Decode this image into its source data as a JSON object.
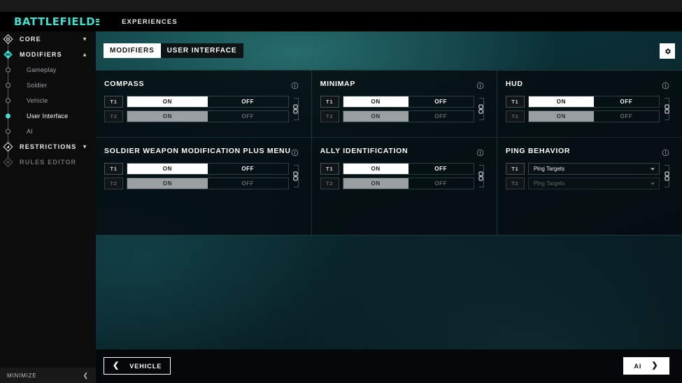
{
  "app": {
    "logo": "BATTLEFIELD",
    "nav_experiences": "EXPERIENCES",
    "accent": "#3fe0d0",
    "minimize_label": "MINIMIZE",
    "minimize_icon": "chevron-left-icon"
  },
  "sidebar": {
    "groups": [
      {
        "label": "CORE",
        "icon": "diamond-core-icon",
        "chevron": "chevron-down-icon",
        "expanded": false
      },
      {
        "label": "MODIFIERS",
        "icon": "diamond-modifiers-icon",
        "chevron": "chevron-up-icon",
        "expanded": true
      },
      {
        "label": "RESTRICTIONS",
        "icon": "diamond-restrictions-icon",
        "chevron": "chevron-down-icon",
        "expanded": false
      },
      {
        "label": "RULES EDITOR",
        "icon": "diamond-rules-icon",
        "chevron": "",
        "expanded": false
      }
    ],
    "modifier_items": [
      {
        "label": "Gameplay",
        "active": false
      },
      {
        "label": "Soldier",
        "active": false
      },
      {
        "label": "Vehicle",
        "active": false
      },
      {
        "label": "User Interface",
        "active": true
      },
      {
        "label": "AI",
        "active": false
      }
    ]
  },
  "tabs": [
    {
      "label": "MODIFIERS",
      "active": true
    },
    {
      "label": "USER INTERFACE",
      "active": false
    }
  ],
  "toolbar": {
    "settings_icon": "gear-icon"
  },
  "cards": [
    {
      "title": "COMPASS",
      "info_icon": "info-icon",
      "link_icon": "link-icon",
      "type": "toggle",
      "options": [
        "ON",
        "OFF"
      ],
      "rows": [
        {
          "team": "T1",
          "value": "ON",
          "enabled": true
        },
        {
          "team": "T2",
          "value": "ON",
          "enabled": false
        }
      ]
    },
    {
      "title": "SOLDIER WEAPON MODIFICATION PLUS MENU",
      "info_icon": "info-icon",
      "link_icon": "link-icon",
      "type": "toggle",
      "options": [
        "ON",
        "OFF"
      ],
      "rows": [
        {
          "team": "T1",
          "value": "ON",
          "enabled": true
        },
        {
          "team": "T2",
          "value": "ON",
          "enabled": false
        }
      ]
    },
    {
      "title": "MINIMAP",
      "info_icon": "info-icon",
      "link_icon": "link-icon",
      "type": "toggle",
      "options": [
        "ON",
        "OFF"
      ],
      "rows": [
        {
          "team": "T1",
          "value": "ON",
          "enabled": true
        },
        {
          "team": "T2",
          "value": "ON",
          "enabled": false
        }
      ]
    },
    {
      "title": "ALLY IDENTIFICATION",
      "info_icon": "info-icon",
      "link_icon": "link-icon",
      "type": "toggle",
      "options": [
        "ON",
        "OFF"
      ],
      "rows": [
        {
          "team": "T1",
          "value": "ON",
          "enabled": true
        },
        {
          "team": "T2",
          "value": "ON",
          "enabled": false
        }
      ]
    },
    {
      "title": "HUD",
      "info_icon": "info-icon",
      "link_icon": "link-icon",
      "type": "toggle",
      "options": [
        "ON",
        "OFF"
      ],
      "rows": [
        {
          "team": "T1",
          "value": "ON",
          "enabled": true
        },
        {
          "team": "T2",
          "value": "ON",
          "enabled": false
        }
      ]
    },
    {
      "title": "PING BEHAVIOR",
      "info_icon": "info-icon",
      "link_icon": "link-icon",
      "type": "dropdown",
      "rows": [
        {
          "team": "T1",
          "value": "Ping Targets",
          "enabled": true
        },
        {
          "team": "T2",
          "value": "Ping Targets",
          "enabled": false
        }
      ]
    }
  ],
  "footer": {
    "prev_label": "VEHICLE",
    "prev_icon": "chevron-left-icon",
    "next_label": "AI",
    "next_icon": "chevron-right-icon"
  }
}
